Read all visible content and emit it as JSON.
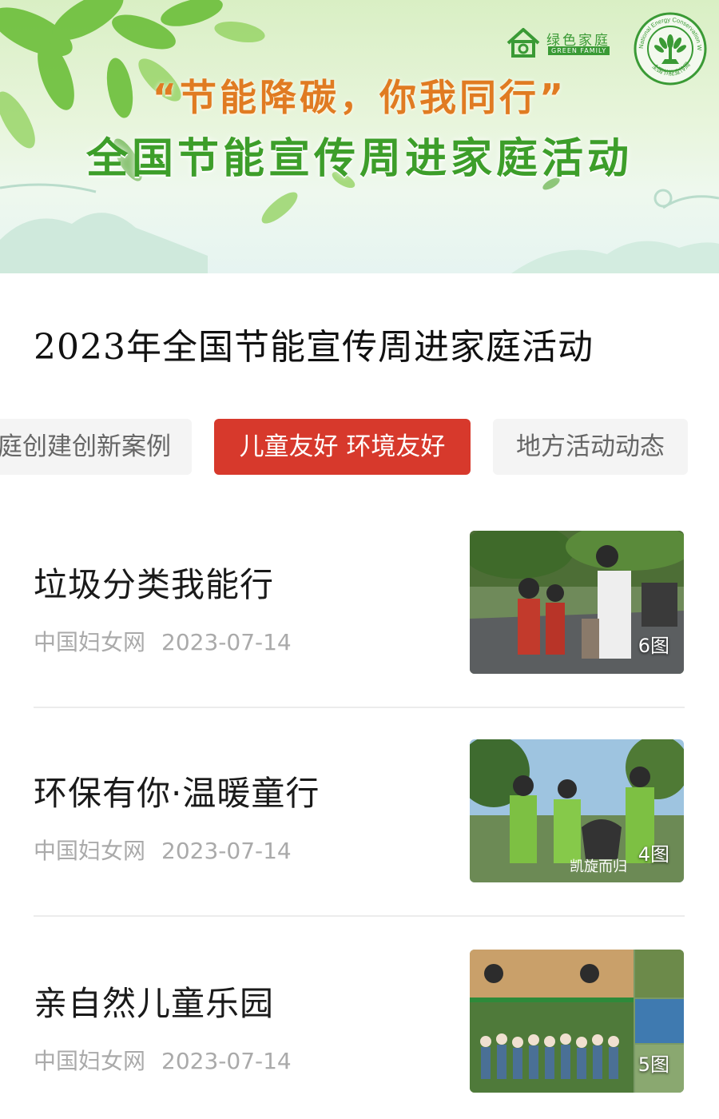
{
  "banner": {
    "slogan": "“节能降碳，你我同行”",
    "headline": "全国节能宣传周进家庭活动",
    "green_family_cn": "绿色家庭",
    "green_family_en": "GREEN FAMILY",
    "nec_logo_en": "National Energy Conservation Week",
    "nec_logo_cn": "全国节能宣传周"
  },
  "section": {
    "title": "2023年全国节能宣传周进家庭活动"
  },
  "tabs": [
    {
      "label": "庭创建创新案例",
      "active": false
    },
    {
      "label": "儿童友好 环境友好",
      "active": true
    },
    {
      "label": "地方活动动态",
      "active": false
    }
  ],
  "articles": [
    {
      "title": "垃圾分类我能行",
      "source": "中国妇女网",
      "date": "2023-07-14",
      "image_count": "6图"
    },
    {
      "title": "环保有你·温暖童行",
      "source": "中国妇女网",
      "date": "2023-07-14",
      "image_count": "4图",
      "image_caption": "凯旋而归"
    },
    {
      "title": "亲自然儿童乐园",
      "source": "中国妇女网",
      "date": "2023-07-14",
      "image_count": "5图"
    }
  ],
  "colors": {
    "accent_red": "#d7392c",
    "slogan_orange": "#e07b22",
    "headline_green": "#3d9e2a",
    "meta_gray": "#aaaaaa"
  }
}
